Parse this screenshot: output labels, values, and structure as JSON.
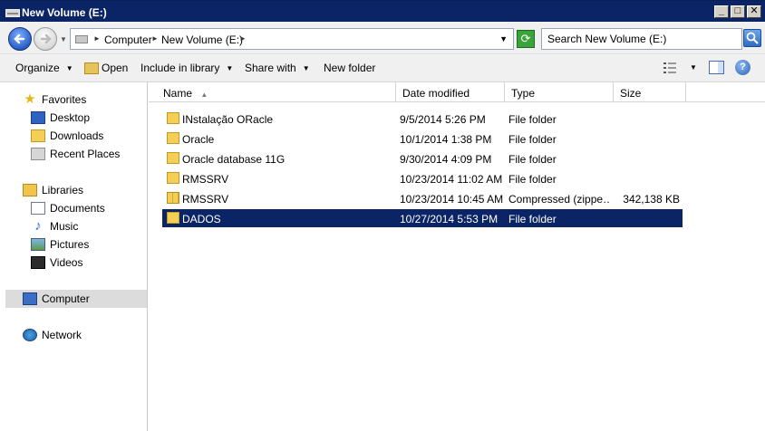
{
  "window": {
    "title": "New Volume (E:)"
  },
  "address": {
    "crumbs": [
      "Computer",
      "New Volume (E:)"
    ]
  },
  "search": {
    "placeholder": "Search New Volume (E:)"
  },
  "toolbar": {
    "organize": "Organize",
    "open": "Open",
    "include_in_library": "Include in library",
    "share_with": "Share with",
    "new_folder": "New folder"
  },
  "nav": {
    "favorites": "Favorites",
    "desktop": "Desktop",
    "downloads": "Downloads",
    "recent_places": "Recent Places",
    "libraries": "Libraries",
    "documents": "Documents",
    "music": "Music",
    "pictures": "Pictures",
    "videos": "Videos",
    "computer": "Computer",
    "network": "Network"
  },
  "columns": {
    "name": "Name",
    "date": "Date modified",
    "type": "Type",
    "size": "Size"
  },
  "files": [
    {
      "name": "INstalação ORacle",
      "date": "9/5/2014 5:26 PM",
      "type": "File folder",
      "size": ""
    },
    {
      "name": "Oracle",
      "date": "10/1/2014 1:38 PM",
      "type": "File folder",
      "size": ""
    },
    {
      "name": "Oracle database 11G",
      "date": "9/30/2014 4:09 PM",
      "type": "File folder",
      "size": ""
    },
    {
      "name": "RMSSRV",
      "date": "10/23/2014 11:02 AM",
      "type": "File folder",
      "size": ""
    },
    {
      "name": "RMSSRV",
      "date": "10/23/2014 10:45 AM",
      "type": "Compressed (zippe…",
      "size": "342,138 KB"
    },
    {
      "name": "DADOS",
      "date": "10/27/2014 5:53 PM",
      "type": "File folder",
      "size": ""
    }
  ],
  "selected_row": 5
}
